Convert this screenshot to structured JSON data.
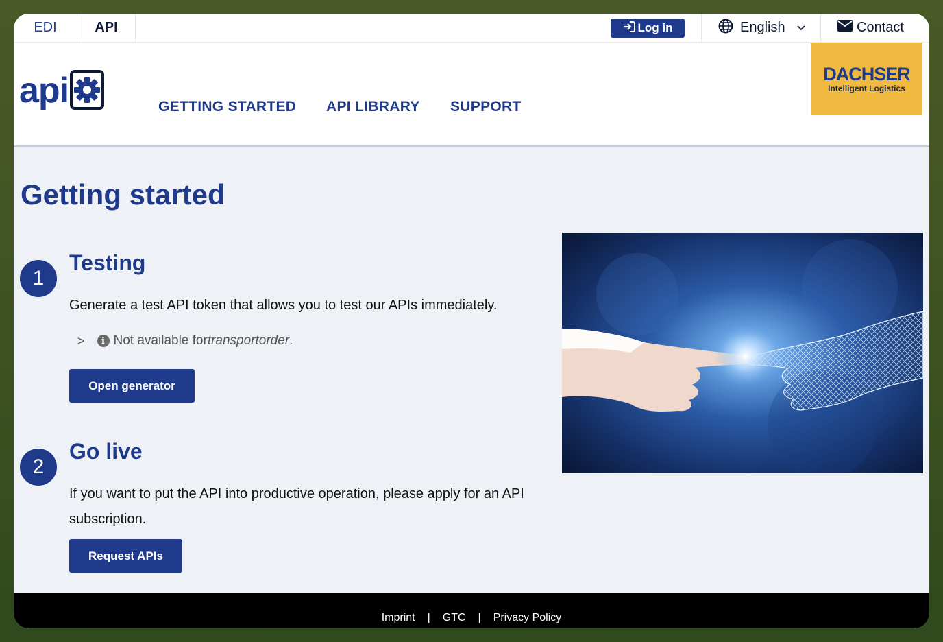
{
  "topbar": {
    "tabs": [
      {
        "label": "EDI"
      },
      {
        "label": "API"
      }
    ],
    "login_label": "Log in",
    "language": "English",
    "contact_label": "Contact"
  },
  "header": {
    "logo_text": "api",
    "nav": [
      {
        "label": "GETTING STARTED"
      },
      {
        "label": "API LIBRARY"
      },
      {
        "label": "SUPPORT"
      }
    ],
    "brand": {
      "name": "DACHSER",
      "tagline": "Intelligent Logistics"
    }
  },
  "main": {
    "title": "Getting started",
    "steps": [
      {
        "number": "1",
        "title": "Testing",
        "text": "Generate a test API token that allows you to test our APIs immediately.",
        "note_prefix": "Not available for ",
        "note_italic": "transportorder",
        "note_suffix": ".",
        "button": "Open generator"
      },
      {
        "number": "2",
        "title": "Go live",
        "text": "If you want to put the API into productive operation, please apply for an API subscription.",
        "button": "Request APIs"
      }
    ]
  },
  "footer": {
    "links": [
      {
        "label": "Imprint"
      },
      {
        "label": "GTC"
      },
      {
        "label": "Privacy Policy"
      }
    ],
    "separator": "|"
  },
  "colors": {
    "primary": "#1f3a8a",
    "brand_yellow": "#f0b93f",
    "page_bg": "#eef1f6",
    "footer_bg": "#000000"
  },
  "icons": [
    "sign-in-icon",
    "globe-icon",
    "chevron-down-icon",
    "envelope-icon",
    "gear-icon",
    "info-icon"
  ]
}
